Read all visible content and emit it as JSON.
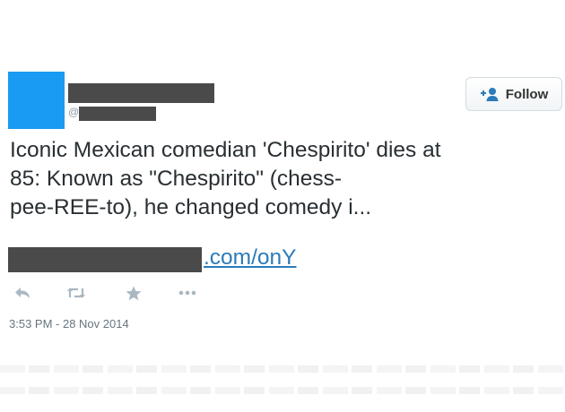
{
  "tweet": {
    "at_sign": "@",
    "follow_label": "Follow",
    "text_lines": [
      "Iconic Mexican comedian 'Chespirito' dies at",
      "85: Known as \"Chespirito\" (chess-",
      "pee-REE-to), he changed comedy i..."
    ],
    "link_suffix": ".com/onY",
    "timestamp": "3:53 PM - 28 Nov 2014",
    "actions": [
      "reply-icon",
      "retweet-icon",
      "favorite-icon",
      "more-icon"
    ]
  },
  "colors": {
    "avatar": "#1a9bf3",
    "redaction": "#4a4a4a",
    "link": "#2b7bb9",
    "text": "#292f33",
    "meta": "#66757f",
    "icon": "#aab8c2"
  }
}
